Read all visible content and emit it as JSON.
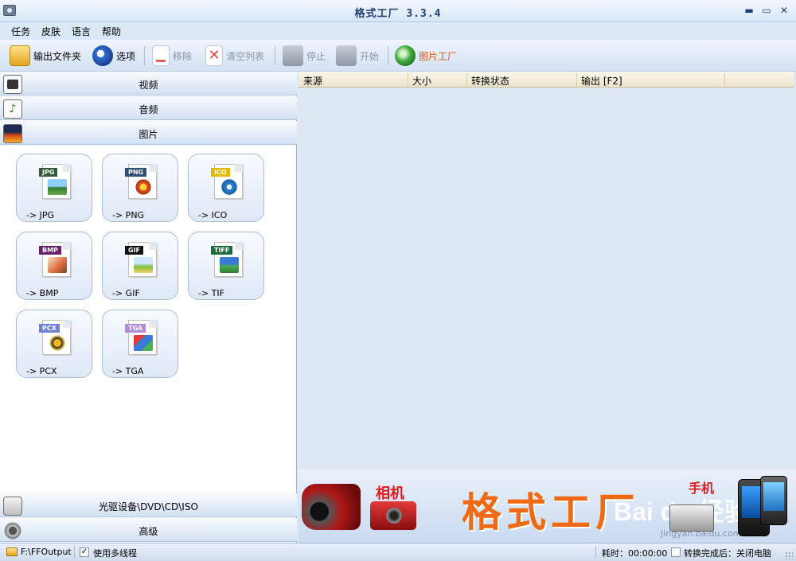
{
  "window": {
    "title": "格式工厂  3.3.4",
    "min": "▬",
    "max": "▭",
    "close": "✕"
  },
  "menu": [
    "任务",
    "皮肤",
    "语言",
    "帮助"
  ],
  "toolbar": {
    "output_folder": "输出文件夹",
    "options": "选项",
    "remove": "移除",
    "clear_list": "清空列表",
    "stop": "停止",
    "start": "开始",
    "picture_factory": "图片工厂"
  },
  "categories": {
    "video": "视频",
    "audio": "音频",
    "picture": "图片",
    "rom": "光驱设备\\DVD\\CD\\ISO",
    "advanced": "高级"
  },
  "tiles": [
    {
      "tag": "JPG",
      "label": "-> JPG",
      "color": "#2f5d3a"
    },
    {
      "tag": "PNG",
      "label": "-> PNG",
      "color": "#2c4e7a"
    },
    {
      "tag": "ICO",
      "label": "-> ICO",
      "color": "#e6b800"
    },
    {
      "tag": "BMP",
      "label": "-> BMP",
      "color": "#6a1f6a"
    },
    {
      "tag": "GIF",
      "label": "-> GIF",
      "color": "#111111"
    },
    {
      "tag": "TIFF",
      "label": "-> TIF",
      "color": "#1f6b3f"
    },
    {
      "tag": "PCX",
      "label": "-> PCX",
      "color": "#6f80d8"
    },
    {
      "tag": "TGA",
      "label": "-> TGA",
      "color": "#b48ad8"
    }
  ],
  "list_columns": [
    "来源",
    "大小",
    "转换状态",
    "输出 [F2]"
  ],
  "banner": {
    "camera": "相机",
    "brand": "格式工厂",
    "phone": "手机",
    "watermark": "Bai du 经验",
    "watermark_url": "jingyan.baidu.com"
  },
  "status": {
    "output_path": "F:\\FFOutput",
    "multithread_label": "使用多线程",
    "multithread_checked": "✓",
    "elapsed": "耗时：00:00:00",
    "after_convert": "转换完成后：关闭电脑"
  }
}
